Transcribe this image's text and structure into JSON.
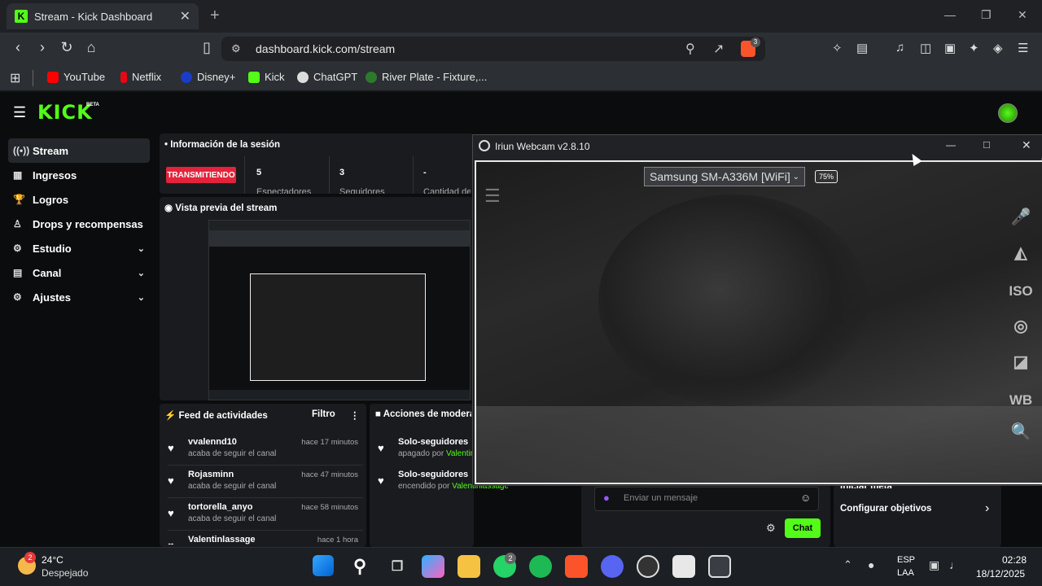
{
  "browser": {
    "tab_title": "Stream - Kick Dashboard",
    "tab_close": "✕",
    "new_tab": "+",
    "url": "dashboard.kick.com/stream",
    "brave_badge": "3",
    "bookmarks": [
      {
        "label": "YouTube",
        "color": "#ff0000"
      },
      {
        "label": "Netflix",
        "color": "#e50914"
      },
      {
        "label": "Disney+",
        "color": "#1a3cc6"
      },
      {
        "label": "Kick",
        "color": "#53fc18"
      },
      {
        "label": "ChatGPT",
        "color": "#dddddd"
      },
      {
        "label": "River Plate - Fixture,...",
        "color": "#d12"
      }
    ]
  },
  "kick": {
    "logo": "KICK",
    "logo_beta": "BETA",
    "sidebar": [
      {
        "label": "Stream",
        "icon": "((•))",
        "chev": ""
      },
      {
        "label": "Ingresos",
        "icon": "▦",
        "chev": ""
      },
      {
        "label": "Logros",
        "icon": "🏆",
        "chev": ""
      },
      {
        "label": "Drops y recompensas",
        "icon": "♙",
        "chev": ""
      },
      {
        "label": "Estudio",
        "icon": "⚙",
        "chev": "⌄"
      },
      {
        "label": "Canal",
        "icon": "▤",
        "chev": "⌄"
      },
      {
        "label": "Ajustes",
        "icon": "⚙",
        "chev": "⌄"
      }
    ],
    "session": {
      "title": "Información de la sesión",
      "live": "TRANSMITIENDO",
      "viewers_value": "5",
      "viewers_label": "Espectadores",
      "followers_value": "3",
      "followers_label": "Seguidores",
      "amount_value": "-",
      "amount_label": "Cantidad de"
    },
    "preview_title": "Vista previa del stream",
    "feed": {
      "title": "Feed de actividades",
      "filter": "Filtro",
      "items": [
        {
          "user": "vvalennd10",
          "desc": "acaba de seguir el canal",
          "time": "hace 17 minutos"
        },
        {
          "user": "Rojasminn",
          "desc": "acaba de seguir el canal",
          "time": "hace 47 minutos"
        },
        {
          "user": "tortorella_anyo",
          "desc": "acaba de seguir el canal",
          "time": "hace 58 minutos"
        },
        {
          "user": "Valentinlassage",
          "desc": "",
          "time": "hace 1 hora"
        }
      ]
    },
    "mod": {
      "title": "Acciones de modera",
      "items": [
        {
          "action": "Solo-seguidores",
          "state": "apagado por",
          "by": "Valentin"
        },
        {
          "action": "Solo-seguidores",
          "state": "encendido por",
          "by": "Valentinlassage"
        }
      ]
    },
    "chat": {
      "placeholder": "Enviar un mensaje",
      "button": "Chat"
    },
    "goals": {
      "partial": "Iniciar meta",
      "configure": "Configurar objetivos"
    }
  },
  "webcam": {
    "title": "Iriun Webcam v2.8.10",
    "device": "Samsung SM-A336M [WiFi]",
    "battery": "75%",
    "tools": [
      "🎤",
      "◭",
      "ISO",
      "◎",
      "◪",
      "WB",
      "🔍"
    ]
  },
  "taskbar": {
    "weather_temp": "24°C",
    "weather_desc": "Despejado",
    "weather_badge": "2",
    "whatsapp_badge": "2",
    "lang1": "ESP",
    "lang2": "LAA",
    "time": "02:28",
    "date": "18/12/2025"
  }
}
